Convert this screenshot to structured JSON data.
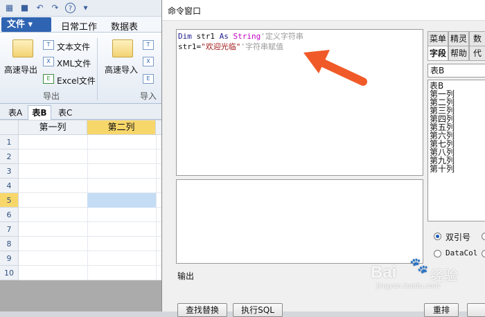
{
  "menubar": {
    "file": "文件",
    "menus": [
      "日常工作",
      "数据表"
    ]
  },
  "ribbon": {
    "export_big": "高速导出",
    "export_items": [
      "文本文件",
      "XML文件",
      "Excel文件"
    ],
    "export_group": "导出",
    "import_big": "高速导入",
    "import_group": "导入"
  },
  "sheet_tabs": [
    "表A",
    "表B",
    "表C"
  ],
  "grid": {
    "columns": [
      "第一列",
      "第二列"
    ],
    "rows": [
      "1",
      "2",
      "3",
      "4",
      "5",
      "6",
      "7",
      "8",
      "9",
      "10"
    ],
    "selected_row": "5"
  },
  "command_window": {
    "title": "命令窗口",
    "code": [
      {
        "kw1": "Dim",
        "name": " str1 ",
        "kw2": "As",
        "type": " String",
        "comment": "'定义字符串"
      },
      {
        "assign": "str1=",
        "string": "\"欢迎光临\"",
        "comment": "'字符串赋值"
      }
    ],
    "output_label": "输出",
    "buttons": {
      "find_replace": "查找替换",
      "exec_sql": "执行SQL",
      "reset": "重排"
    }
  },
  "side_panel": {
    "tabs_row1": [
      "菜单",
      "精灵",
      "数据"
    ],
    "tabs_row2": [
      "字段",
      "帮助",
      "代码"
    ],
    "table_select": "表B",
    "fields": [
      "表B",
      "第一列",
      "第二列",
      "第三列",
      "第四列",
      "第五列",
      "第六列",
      "第七列",
      "第八列",
      "第九列",
      "第十列"
    ],
    "radio1": "双引号",
    "radio2": "DataCol"
  },
  "watermark": {
    "brand": "Bai",
    "brand2": "经验",
    "url": "jingyan.baidu.com"
  },
  "colors": {
    "accent": "#2f64b3",
    "arrow": "#f05a28",
    "selected_col": "#f8d76a",
    "selected_cell": "#c5dcf5"
  }
}
